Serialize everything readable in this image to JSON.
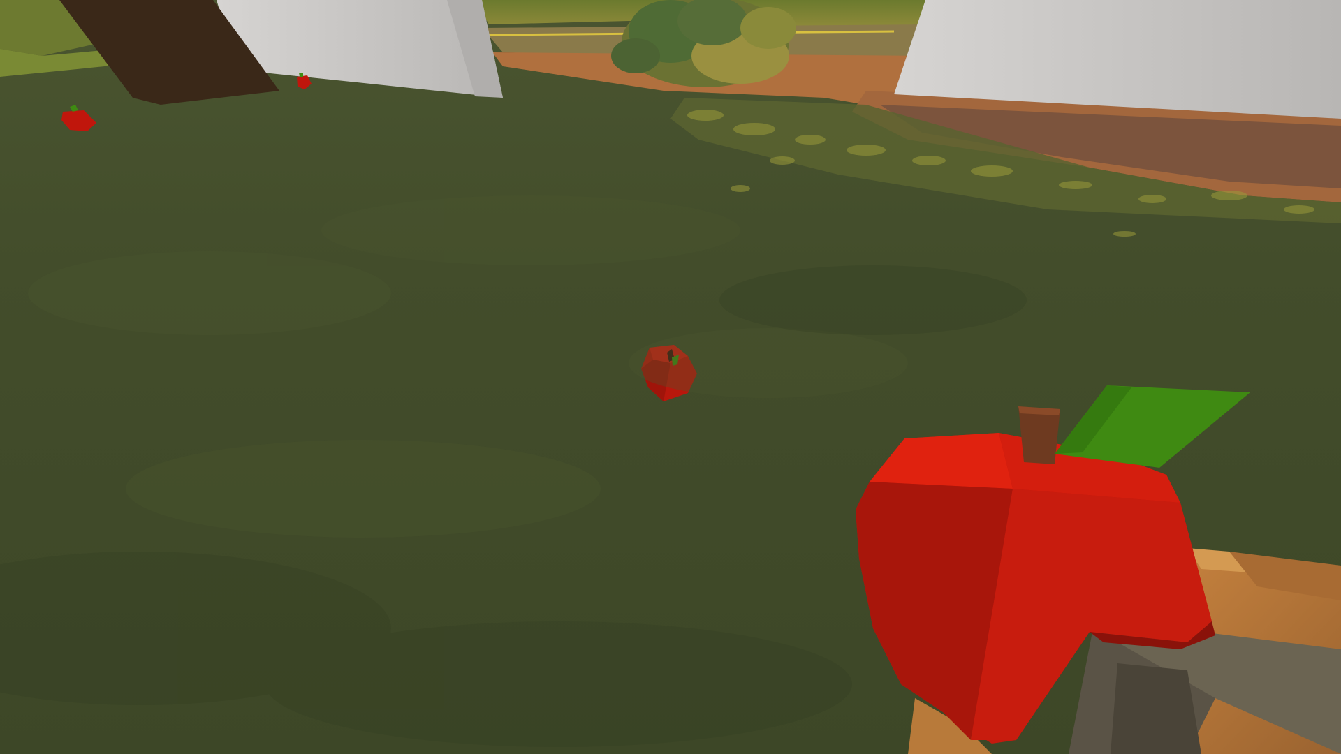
{
  "scene": {
    "view": "first-person",
    "held_item": "apple",
    "dropped_items": [
      "apple",
      "apple",
      "apple"
    ],
    "environment": {
      "ground": "grass",
      "structures": [
        "tree-trunk",
        "stone-wall",
        "stone-wall",
        "bush",
        "dirt-road"
      ]
    }
  },
  "colors": {
    "grass": "#3f4a28",
    "grass_dark": "#384225",
    "grass_light": "#4a5530",
    "wall": "#c9c9c9",
    "wall_shadow": "#9a9898",
    "trunk": "#3a2818",
    "road": "#b0703e",
    "road_shadow": "#6b4a3c",
    "bush": "#8a8a3a",
    "bush_dark": "#556b2f",
    "apple_red": "#d8200e",
    "apple_dark": "#a8180c",
    "apple_mid": "#c41a0e",
    "stem": "#6e3a20",
    "leaf": "#3f8a12",
    "tool_wood": "#b87a3a",
    "tool_handle": "#555044"
  }
}
